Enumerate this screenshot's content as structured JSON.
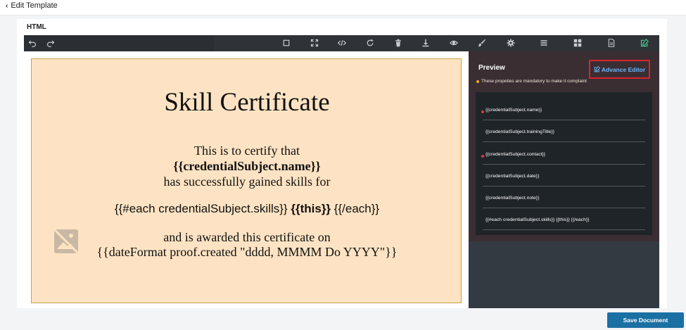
{
  "header": {
    "back_label": "Edit Template"
  },
  "editor": {
    "type_label": "HTML",
    "toolbar": {
      "left_icons": [
        "undo-icon",
        "redo-icon"
      ],
      "right_icons": [
        "square-icon",
        "fullscreen-icon",
        "code-icon",
        "reload-icon",
        "trash-icon",
        "download-icon",
        "eye-icon",
        "brush-icon",
        "gear-icon",
        "menu-icon",
        "blocks-icon",
        "page-icon",
        "edit-icon"
      ],
      "active_icon": "edit-icon",
      "active_color": "#4ad38c"
    }
  },
  "certificate": {
    "title": "Skill Certificate",
    "line1": "This is to certify that",
    "name_placeholder": "{{credentialSubject.name}}",
    "line3": "has successfully gained skills for",
    "skills_prefix": "{{#each credentialSubject.skills}}",
    "skills_this": "{{this}}",
    "skills_suffix": "{{/each}}",
    "awarded_line": "and is awarded this certificate on",
    "date_line": "{{dateFormat proof.created \"dddd, MMMM Do YYYY\"}}",
    "background_color": "#fde3c3",
    "border_color": "#c4a24a",
    "image_icon": "broken-image-icon"
  },
  "preview": {
    "title": "Preview",
    "advance_editor_label": "Advance Editor",
    "mandatory_note": "These propeties are mandatory to make it complaint",
    "fields": [
      {
        "text": "{{credentialSubject.name}}",
        "required": true
      },
      {
        "text": "{{credentialSubject.trainingTitle}}",
        "required": false
      },
      {
        "text": "{{credentialSubject.contact}}",
        "required": true
      },
      {
        "text": "{{credentialSubject.date}}",
        "required": false
      },
      {
        "text": "{{credentialSubject.note}}",
        "required": false
      },
      {
        "text": "{{#each credentialSubject.skills}} {{this}} {{/each}}",
        "required": false
      }
    ],
    "required_color": "#e0383e",
    "note_dot_color": "#f5a623"
  },
  "footer": {
    "save_label": "Save Document"
  }
}
